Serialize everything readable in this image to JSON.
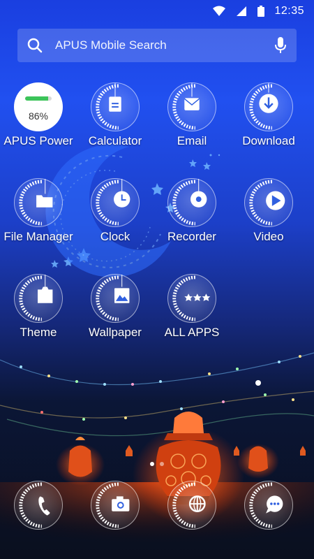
{
  "status_bar": {
    "time": "12:35",
    "icons": [
      "wifi-icon",
      "signal-icon",
      "battery-icon"
    ]
  },
  "search": {
    "placeholder": "APUS Mobile Search",
    "icon": "search-icon",
    "voice_icon": "mic-icon"
  },
  "apps": [
    {
      "label": "APUS Power",
      "icon": "battery-gauge-icon",
      "percent_text": "86%",
      "level": 0.86
    },
    {
      "label": "Calculator",
      "icon": "calculator-icon"
    },
    {
      "label": "Email",
      "icon": "mail-icon"
    },
    {
      "label": "Download",
      "icon": "download-icon"
    },
    {
      "label": "File Manager",
      "icon": "folder-icon"
    },
    {
      "label": "Clock",
      "icon": "clock-icon"
    },
    {
      "label": "Recorder",
      "icon": "recorder-icon"
    },
    {
      "label": "Video",
      "icon": "play-icon"
    },
    {
      "label": "Theme",
      "icon": "theme-icon"
    },
    {
      "label": "Wallpaper",
      "icon": "wallpaper-icon"
    },
    {
      "label": "ALL APPS",
      "icon": "stars-icon"
    }
  ],
  "page_indicator": {
    "pages": 2,
    "active": 1
  },
  "dock": [
    {
      "name": "phone",
      "icon": "phone-icon"
    },
    {
      "name": "camera",
      "icon": "camera-icon"
    },
    {
      "name": "browser",
      "icon": "globe-icon"
    },
    {
      "name": "messages",
      "icon": "chat-icon"
    }
  ],
  "colors": {
    "accent_green": "#3cc45a",
    "background_top": "#1a3fe0",
    "background_bottom": "#0a0f1e",
    "lantern": "#ff5a1a"
  }
}
